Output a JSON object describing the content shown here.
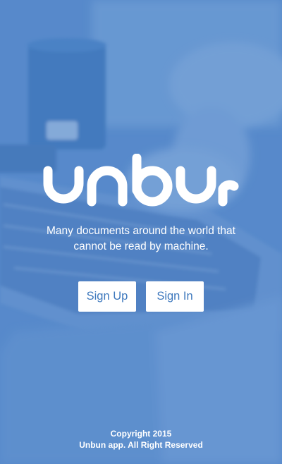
{
  "app": {
    "logo_text": "unbun",
    "tagline_line1": "Many documents around the world that",
    "tagline_line2": "cannot be read by machine."
  },
  "actions": {
    "signup_label": "Sign Up",
    "signin_label": "Sign In"
  },
  "footer": {
    "copyright": "Copyright 2015",
    "rights": "Unbun app. All Right Reserved"
  },
  "colors": {
    "background": "#5a8ac8",
    "button_bg": "#ffffff",
    "button_text": "#3d78bd",
    "text": "#ffffff"
  }
}
